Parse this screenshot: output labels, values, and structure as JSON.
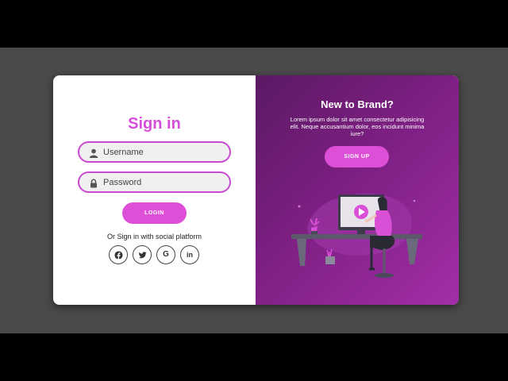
{
  "signin": {
    "title": "Sign in",
    "username_placeholder": "Username",
    "password_placeholder": "Password",
    "login_label": "LOGIN",
    "social_text": "Or Sign in with social platform",
    "social_icons": [
      "facebook-icon",
      "twitter-icon",
      "google-icon",
      "linkedin-icon"
    ],
    "google_glyph": "G",
    "linkedin_glyph": "in",
    "facebook_glyph": "f"
  },
  "signup_panel": {
    "title": "New to Brand?",
    "text": "Lorem ipsum dolor sit amet consectetur adipisicing elit. Neque accusantium dolor, eos incidunt minima iure?",
    "signup_label": "SIGN UP"
  },
  "colors": {
    "accent": "#dd4fd7",
    "panel_dark": "#5a1a63",
    "panel_light": "#a22ea8",
    "field_border": "#c84ad0"
  }
}
